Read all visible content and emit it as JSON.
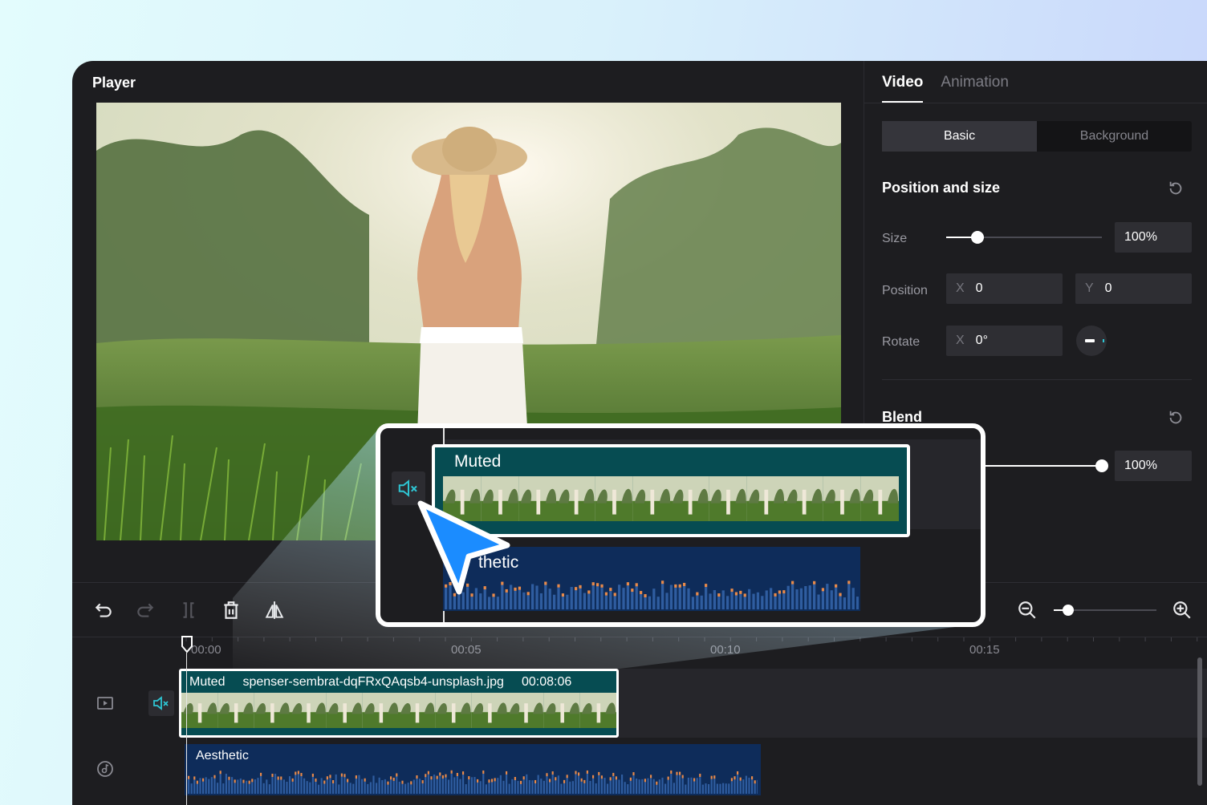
{
  "player": {
    "title": "Player"
  },
  "panel": {
    "tabs": [
      {
        "label": "Video",
        "active": true
      },
      {
        "label": "Animation",
        "active": false
      }
    ],
    "segments": [
      {
        "label": "Basic",
        "active": true
      },
      {
        "label": "Background",
        "active": false
      }
    ],
    "position_and_size": {
      "title": "Position and size",
      "size": {
        "label": "Size",
        "value": "100%",
        "level_fraction": 0.2
      },
      "position": {
        "label": "Position",
        "x_axis": "X",
        "x_value": "0",
        "y_axis": "Y",
        "y_value": "0"
      },
      "rotate": {
        "label": "Rotate",
        "x_axis": "X",
        "x_value": "0°"
      }
    },
    "blend": {
      "title": "Blend",
      "value": "100%",
      "level_fraction": 1.0
    }
  },
  "timeline": {
    "ruler": [
      "00:00",
      "00:05",
      "00:10",
      "00:15"
    ],
    "video_clip": {
      "status": "Muted",
      "filename": "spenser-sembrat-dqFRxQAqsb4-unsplash.jpg",
      "duration": "00:08:06"
    },
    "audio_clip": {
      "name": "Aesthetic"
    },
    "zoom_level_fraction": 0.15
  },
  "callout": {
    "video_status": "Muted",
    "audio_name_partial": "thetic"
  },
  "icons": [
    "undo-icon",
    "redo-icon",
    "split-icon",
    "delete-icon",
    "mirror-icon",
    "zoom-out-icon",
    "zoom-in-icon",
    "mute-icon",
    "video-track-icon",
    "audio-track-icon",
    "reset-icon",
    "rotate-dial-icon",
    "cursor-arrow-icon"
  ],
  "colors": {
    "accent": "#2ec5d3",
    "video_clip": "#064c52",
    "audio_clip": "#0e2c5a",
    "cursor": "#1b8cff"
  }
}
